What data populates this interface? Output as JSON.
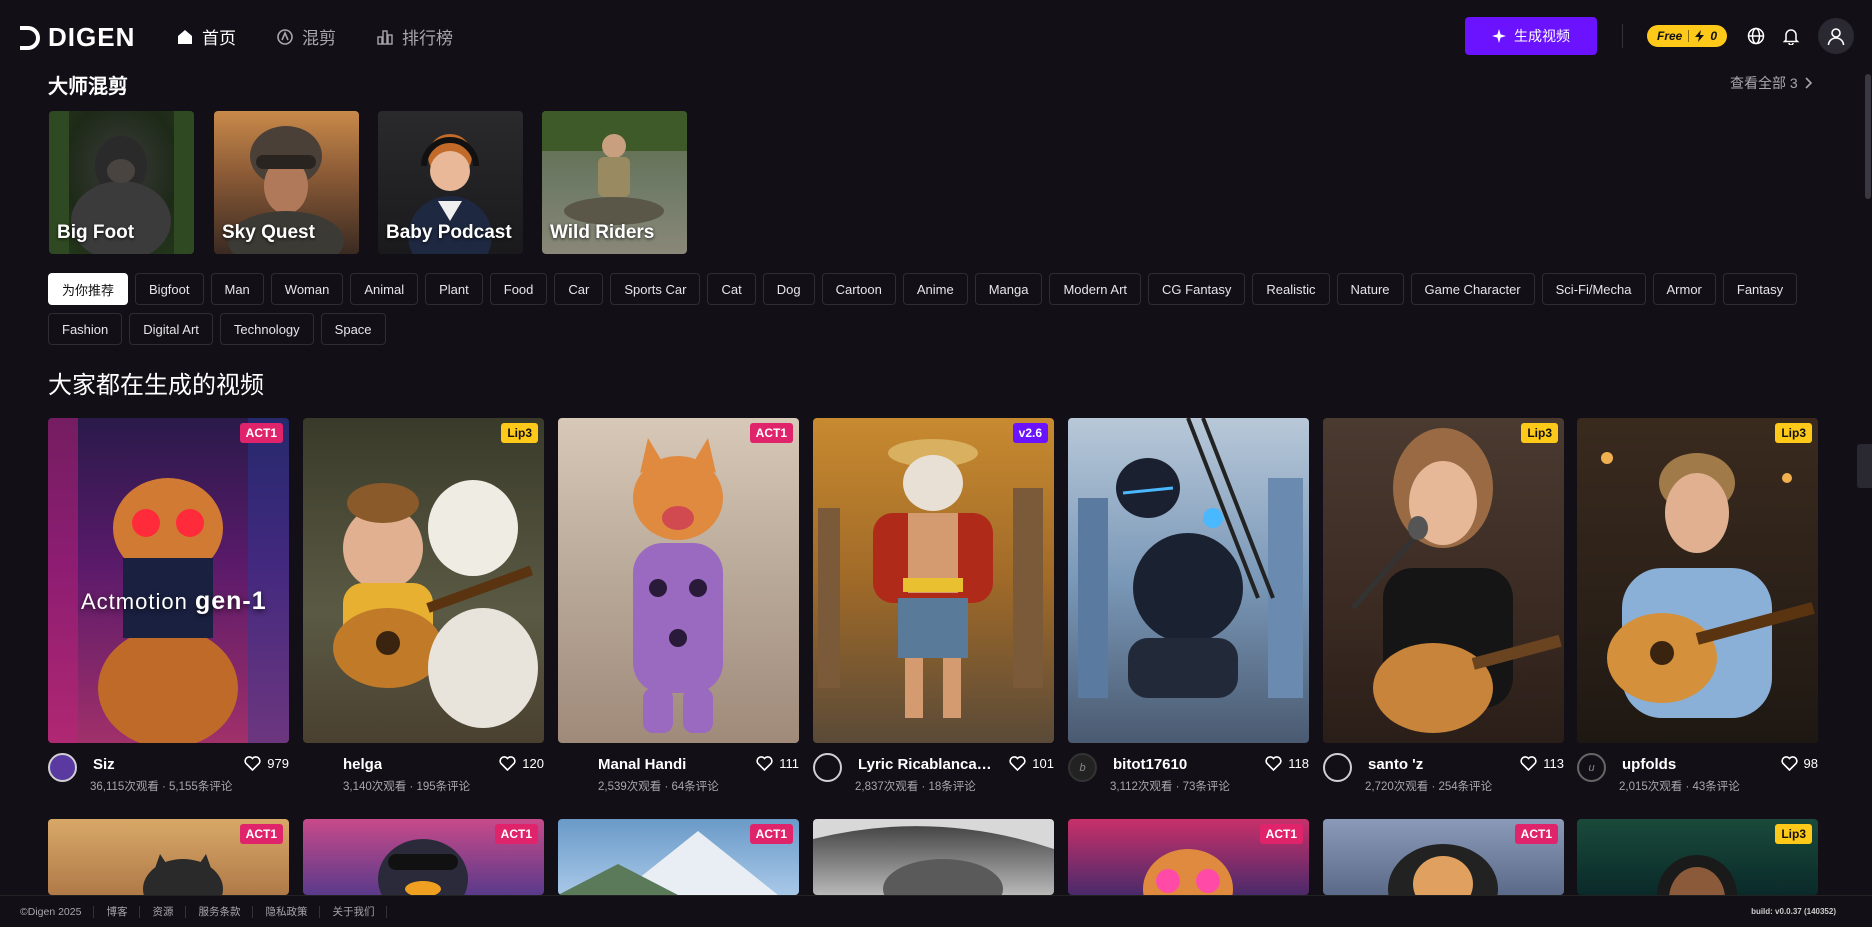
{
  "brand": {
    "name": "DIGEN"
  },
  "nav": [
    {
      "label": "首页",
      "icon": "home-icon",
      "active": true
    },
    {
      "label": "混剪",
      "icon": "remix-icon",
      "active": false
    },
    {
      "label": "排行榜",
      "icon": "ranking-icon",
      "active": false
    }
  ],
  "header": {
    "generate_label": "生成视频",
    "free_label": "Free",
    "credits": "0"
  },
  "masters": {
    "title": "大师混剪",
    "view_all": "查看全部 3",
    "items": [
      {
        "label": "Big Foot"
      },
      {
        "label": "Sky Quest"
      },
      {
        "label": "Baby Podcast"
      },
      {
        "label": "Wild Riders"
      }
    ]
  },
  "tags": [
    "为你推荐",
    "Bigfoot",
    "Man",
    "Woman",
    "Animal",
    "Plant",
    "Food",
    "Car",
    "Sports Car",
    "Cat",
    "Dog",
    "Cartoon",
    "Anime",
    "Manga",
    "Modern Art",
    "CG Fantasy",
    "Realistic",
    "Nature",
    "Game Character",
    "Sci-Fi/Mecha",
    "Armor",
    "Fantasy",
    "Fashion",
    "Digital Art",
    "Technology",
    "Space"
  ],
  "videos": {
    "title": "大家都在生成的视频",
    "row1": [
      {
        "badge": "ACT1",
        "user": "Siz",
        "stats": "36,115次观看 · 5,155条评论",
        "likes": "979",
        "overlay_a": "Actmotion ",
        "overlay_b": "gen-1"
      },
      {
        "badge": "Lip3",
        "user": "helga",
        "stats": "3,140次观看 · 195条评论",
        "likes": "120"
      },
      {
        "badge": "ACT1",
        "user": "Manal Handi",
        "stats": "2,539次观看 · 64条评论",
        "likes": "111"
      },
      {
        "badge": "v2.6",
        "user": "Lyric Ricablanca ...",
        "stats": "2,837次观看 · 18条评论",
        "likes": "101"
      },
      {
        "badge": "",
        "user": "bitot17610",
        "stats": "3,112次观看 · 73条评论",
        "likes": "118",
        "avatar_letter": "b"
      },
      {
        "badge": "Lip3",
        "user": "santo 'z",
        "stats": "2,720次观看 · 254条评论",
        "likes": "113"
      },
      {
        "badge": "Lip3",
        "user": "upfolds",
        "stats": "2,015次观看 · 43条评论",
        "likes": "98",
        "avatar_letter": "u"
      }
    ],
    "row2": [
      {
        "badge": "ACT1"
      },
      {
        "badge": "ACT1"
      },
      {
        "badge": "ACT1"
      },
      {
        "badge": ""
      },
      {
        "badge": "ACT1"
      },
      {
        "badge": "ACT1"
      },
      {
        "badge": "Lip3"
      }
    ]
  },
  "footer": {
    "items": [
      "©Digen 2025",
      "博客",
      "资源",
      "服务条款",
      "隐私政策",
      "关于我们"
    ],
    "build": "build:  v0.0.37 (140352)"
  },
  "colors": {
    "accent": "#6b12ff",
    "free": "#ffc919",
    "act": "#e0246c"
  }
}
